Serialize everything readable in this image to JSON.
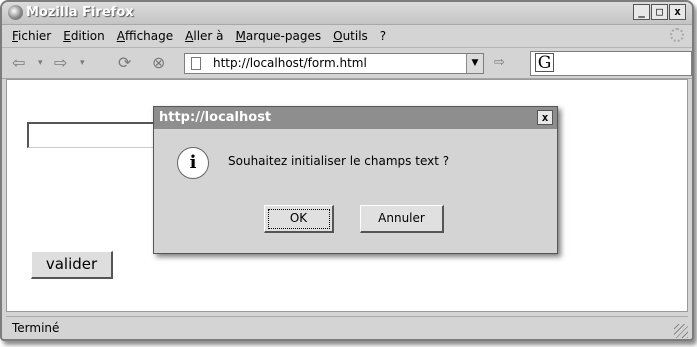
{
  "window": {
    "title": "Mozilla Firefox",
    "controls": {
      "minimize": "_",
      "maximize": "□",
      "close": "x"
    }
  },
  "menu": [
    "Fichier",
    "Edition",
    "Affichage",
    "Aller à",
    "Marque-pages",
    "Outils",
    "?"
  ],
  "navigation": {
    "back": "⇦",
    "forward": "⇨",
    "reload": "⟳",
    "stop": "⊗",
    "url": "http://localhost/form.html",
    "dropdown": "▼",
    "go": "⇨",
    "search_engine": "G",
    "search_value": ""
  },
  "page": {
    "text_field_value": "",
    "submit_label": "valider"
  },
  "status": {
    "text": "Terminé"
  },
  "dialog": {
    "title": "http://localhost",
    "close": "x",
    "icon": "i",
    "message": "Souhaitez initialiser le champs text ?",
    "ok_label": "OK",
    "cancel_label": "Annuler"
  },
  "icons": [
    "firefox-icon",
    "back-arrow-icon",
    "forward-arrow-icon",
    "reload-icon",
    "stop-icon",
    "page-icon",
    "go-icon",
    "google-icon",
    "throbber-icon",
    "info-icon",
    "resize-grip-icon"
  ]
}
